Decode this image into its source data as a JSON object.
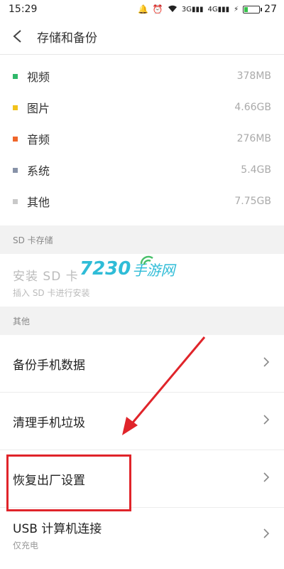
{
  "status": {
    "time": "15:29",
    "net_3g": "3G",
    "net_4g": "4G",
    "battery": "27",
    "battery_level": 0.27
  },
  "header": {
    "title": "存储和备份"
  },
  "usage": [
    {
      "label": "视频",
      "value": "378MB",
      "color": "#2fb86a"
    },
    {
      "label": "图片",
      "value": "4.66GB",
      "color": "#f2c21b"
    },
    {
      "label": "音频",
      "value": "276MB",
      "color": "#f0662a"
    },
    {
      "label": "系统",
      "value": "5.4GB",
      "color": "#8792a8"
    },
    {
      "label": "其他",
      "value": "7.75GB",
      "color": "#c9c9c9"
    }
  ],
  "sd_section": {
    "header": "SD 卡存储",
    "title": "安装 SD 卡",
    "subtitle": "插入 SD 卡进行安装"
  },
  "watermark": {
    "number": "7230",
    "text": "手游网"
  },
  "other_section": {
    "header": "其他",
    "items": [
      {
        "label": "备份手机数据"
      },
      {
        "label": "清理手机垃圾"
      },
      {
        "label": "恢复出厂设置"
      },
      {
        "label": "USB 计算机连接",
        "subtitle": "仅充电"
      }
    ]
  },
  "annotation_color": "#e0242a"
}
